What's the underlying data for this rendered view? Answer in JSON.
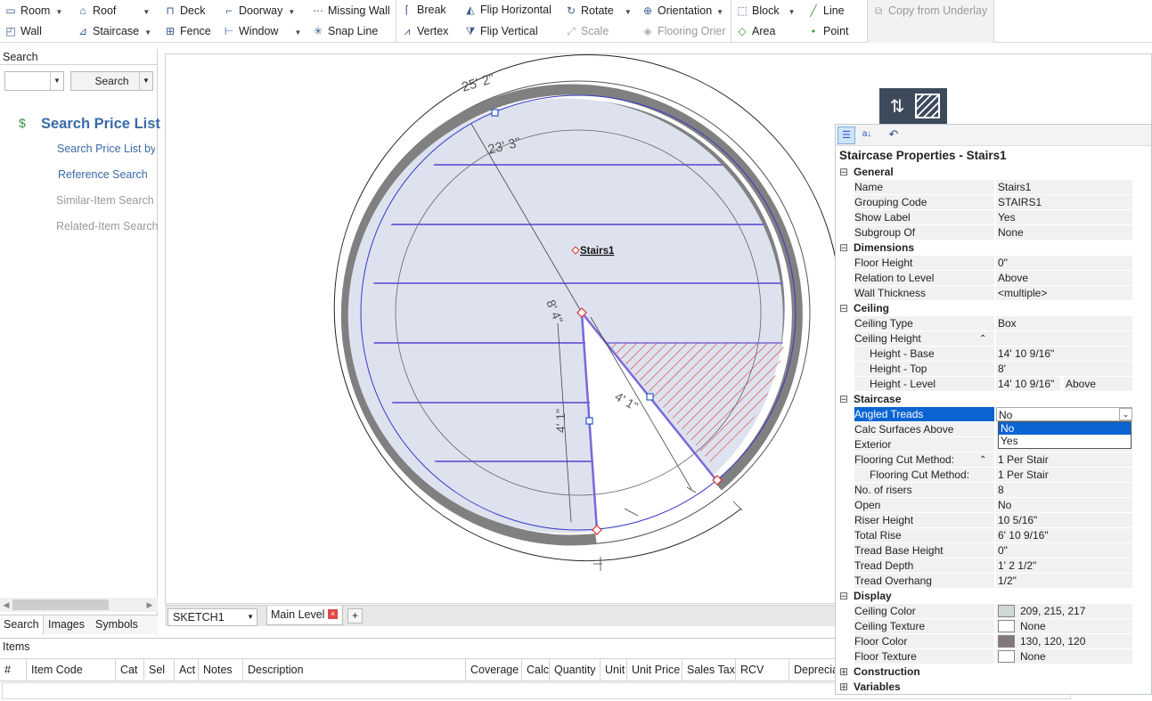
{
  "ribbon": {
    "room": "Room",
    "roof": "Roof",
    "deck": "Deck",
    "doorway": "Doorway",
    "missing_wall": "Missing Wall",
    "wall": "Wall",
    "staircase": "Staircase",
    "fence": "Fence",
    "window": "Window",
    "snap_line": "Snap Line",
    "break": "Break",
    "flip_horizontal": "Flip Horizontal",
    "rotate": "Rotate",
    "orientation": "Orientation",
    "vertex": "Vertex",
    "flip_vertical": "Flip Vertical",
    "scale": "Scale",
    "flooring_orientation": "Flooring Orier",
    "block": "Block",
    "line": "Line",
    "area": "Area",
    "point": "Point",
    "copy_underlay": "Copy from Underlay"
  },
  "left_panel": {
    "header": "Search",
    "search_value": "",
    "search_button": "Search",
    "title": "Search Price List",
    "links": [
      "Search Price List by I",
      "Reference Search",
      "Similar-Item Search",
      "Related-Item Search"
    ],
    "tabs": [
      "Search",
      "Images",
      "Symbols"
    ]
  },
  "canvas": {
    "label_stairs": "Stairs1",
    "dim_outer": "25' 2\"",
    "dim_inner": "23' 3\"",
    "dim_radius": "8' 4\"",
    "dim_side_a": "4' 1\"",
    "dim_side_b": "4' 1\""
  },
  "sheet_tabs": {
    "sketch_select": "SKETCH1",
    "level_tab": "Main Level",
    "add": "+"
  },
  "items": {
    "header": "Items",
    "columns": [
      "#",
      "Item Code",
      "Cat",
      "Sel",
      "Act",
      "Notes",
      "Description",
      "Coverage",
      "Calc",
      "Quantity",
      "Unit",
      "Unit Price",
      "Sales Tax",
      "RCV",
      "Deprecia"
    ]
  },
  "props": {
    "title": "Staircase Properties - Stairs1",
    "sections": {
      "general": "General",
      "dimensions": "Dimensions",
      "ceiling": "Ceiling",
      "staircase": "Staircase",
      "display": "Display",
      "construction": "Construction",
      "variables": "Variables"
    },
    "rows": {
      "name": [
        "Name",
        "Stairs1"
      ],
      "grouping_code": [
        "Grouping Code",
        "STAIRS1"
      ],
      "show_label": [
        "Show Label",
        "Yes"
      ],
      "subgroup_of": [
        "Subgroup Of",
        "None"
      ],
      "floor_height": [
        "Floor Height",
        "0\""
      ],
      "relation_to_level": [
        "Relation to Level",
        "Above"
      ],
      "wall_thickness": [
        "Wall Thickness",
        "<multiple>"
      ],
      "ceiling_type": [
        "Ceiling Type",
        "Box"
      ],
      "ceiling_height": [
        "Ceiling Height",
        ""
      ],
      "height_base": [
        "Height - Base",
        "14' 10 9/16\""
      ],
      "height_top": [
        "Height - Top",
        "8'"
      ],
      "height_level": [
        "Height - Level",
        "14' 10 9/16\""
      ],
      "height_level_extra": "Above",
      "angled_treads": [
        "Angled Treads",
        "No"
      ],
      "calc_surfaces": [
        "Calc Surfaces Above",
        ""
      ],
      "exterior": [
        "Exterior",
        ""
      ],
      "flooring_cut": [
        "Flooring Cut Method:",
        "1 Per Stair"
      ],
      "flooring_cut_sub": [
        "Flooring Cut Method:",
        "1 Per Stair"
      ],
      "no_of_risers": [
        "No. of risers",
        "8"
      ],
      "open": [
        "Open",
        "No"
      ],
      "riser_height": [
        "Riser Height",
        "10 5/16\""
      ],
      "total_rise": [
        "Total Rise",
        "6' 10 9/16\""
      ],
      "tread_base_height": [
        "Tread Base Height",
        "0\""
      ],
      "tread_depth": [
        "Tread Depth",
        "1' 2 1/2\""
      ],
      "tread_overhang": [
        "Tread Overhang",
        " 1/2\""
      ],
      "ceiling_color": [
        "Ceiling Color",
        "209, 215, 217"
      ],
      "ceiling_texture": [
        "Ceiling Texture",
        "None"
      ],
      "floor_color": [
        "Floor Color",
        "130, 120, 120"
      ],
      "floor_texture": [
        "Floor Texture",
        "None"
      ]
    },
    "dropdown_options": [
      "No",
      "Yes"
    ],
    "colors": {
      "ceiling": "#d1d7d9",
      "floor": "#827878",
      "selection": "#0a64d2"
    }
  }
}
